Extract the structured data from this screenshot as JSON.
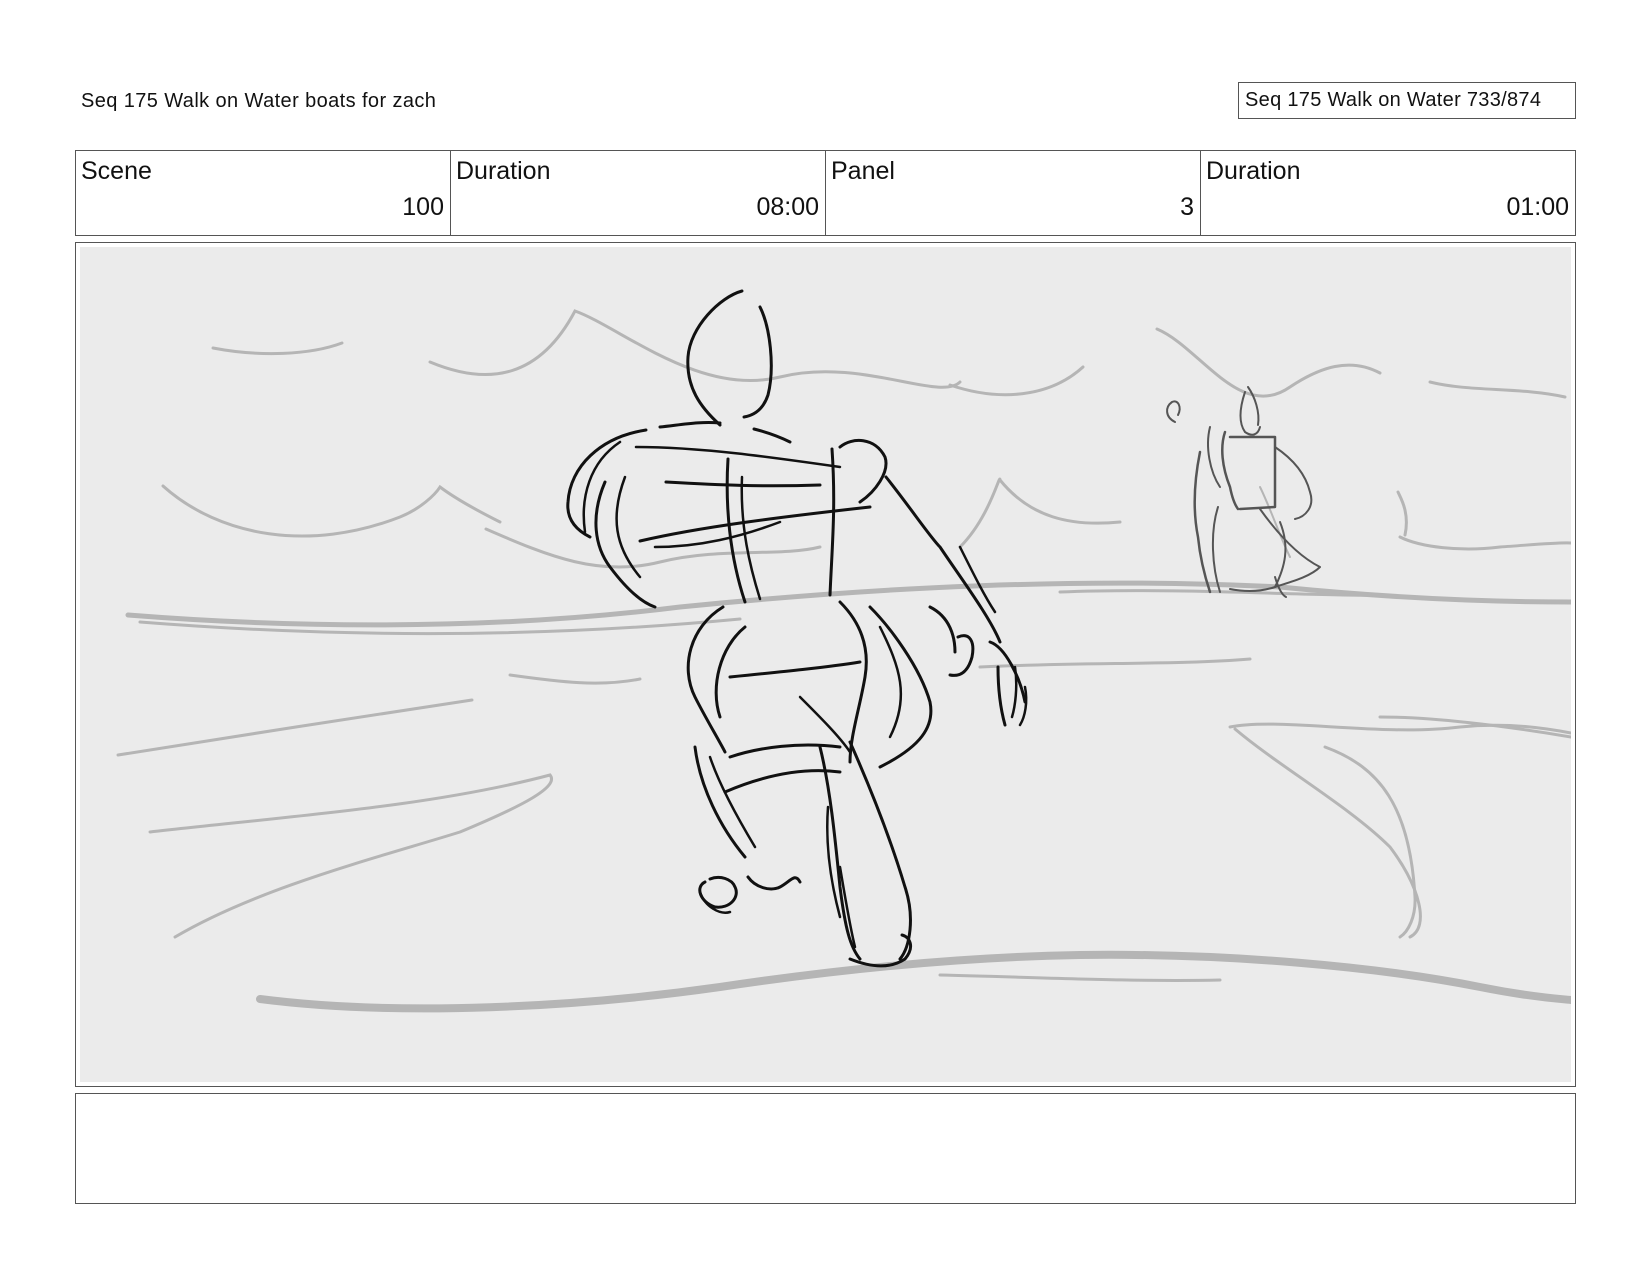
{
  "header": {
    "title": "Seq 175 Walk on Water  boats for zach",
    "page_label": "Seq 175 Walk on Water 733/874"
  },
  "info": {
    "scene_label": "Scene",
    "scene_value": "100",
    "scene_duration_label": "Duration",
    "scene_duration_value": "08:00",
    "panel_label": "Panel",
    "panel_value": "3",
    "panel_duration_label": "Duration",
    "panel_duration_value": "01:00"
  },
  "notes": {
    "text": ""
  },
  "colors": {
    "panel_background": "#ebebeb",
    "sketch_dark": "#111111",
    "sketch_light": "#b5b5b5",
    "border": "#555555"
  }
}
